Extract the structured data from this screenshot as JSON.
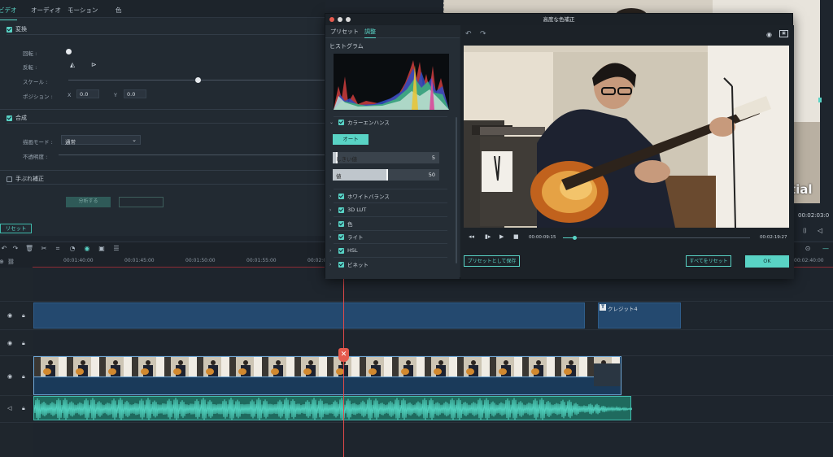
{
  "property_panel": {
    "tabs": [
      "ビデオ",
      "オーディオ",
      "モーション",
      "色"
    ],
    "transform": {
      "header": "変換",
      "rotate": "回転 :",
      "flip": "反転 :",
      "scale": "スケール :",
      "position": "ポジション :",
      "x_label": "X",
      "x_value": "0.0",
      "y_label": "Y",
      "y_value": "0.0"
    },
    "compositing": {
      "header": "合成",
      "blend_mode_label": "描画モード :",
      "blend_mode_value": "通常",
      "opacity_label": "不透明度 :"
    },
    "stabilization": {
      "header": "手ぶれ補正",
      "analyze_button": "分析する",
      "settings_button": ""
    },
    "reset_button": "リセット"
  },
  "dialog": {
    "title": "高度な色補正",
    "tabs": [
      "プリセット",
      "調整"
    ],
    "active_tab": "調整",
    "histogram_label": "ヒストグラム",
    "color_enhance": {
      "label": "カラーエンハンス",
      "auto_button": "オート",
      "threshold_label": "しきい値",
      "threshold_value": "5",
      "threshold_fraction": 0.03,
      "value_label": "値",
      "value_value": "50",
      "value_fraction": 0.5
    },
    "sections": [
      "ホワイトバランス",
      "3D LUT",
      "色",
      "ライト",
      "HSL",
      "ビネット"
    ],
    "preview": {
      "current_time": "00:00:09:15",
      "total_time": "00:02:19:27",
      "progress_fraction": 0.06
    },
    "save_preset_button": "プリセットとして保存",
    "reset_all_button": "すべてをリセット",
    "ok_button": "OK"
  },
  "background_preview": {
    "caption": "tial",
    "timecode": "00:02:03:0"
  },
  "timeline": {
    "ruler_ticks": [
      "00:01:40:00",
      "00:01:45:00",
      "00:01:50:00",
      "00:01:55:00",
      "00:02:0",
      "00:02:40:00"
    ],
    "title_clip": "クレジット4",
    "title_clip_icon": "T"
  },
  "colors": {
    "accent": "#59d3c5",
    "playhead": "#e14a4a",
    "title_clip": "#24496f",
    "audio_clip": "#1f6a5e"
  }
}
